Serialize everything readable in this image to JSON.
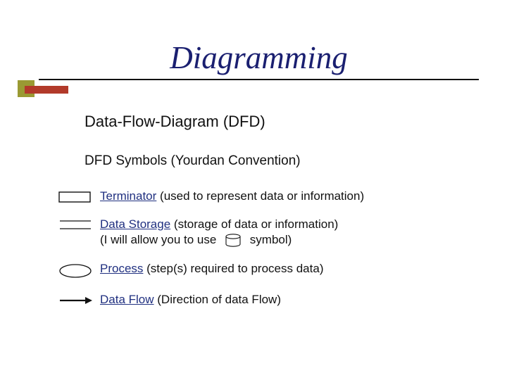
{
  "title": "Diagramming",
  "subtitle": "Data-Flow-Diagram (DFD)",
  "section_heading": "DFD Symbols (Yourdan Convention)",
  "items": [
    {
      "label": "Terminator",
      "description": " (used to represent data or information)"
    },
    {
      "label": "Data Storage",
      "description_before": " (storage of data or information)",
      "description_line2a": "(I will allow you to use ",
      "description_line2b": " symbol)"
    },
    {
      "label": "Process",
      "description": " (step(s) required to process data)"
    },
    {
      "label": "Data Flow",
      "description": " (Direction of data Flow)"
    }
  ]
}
